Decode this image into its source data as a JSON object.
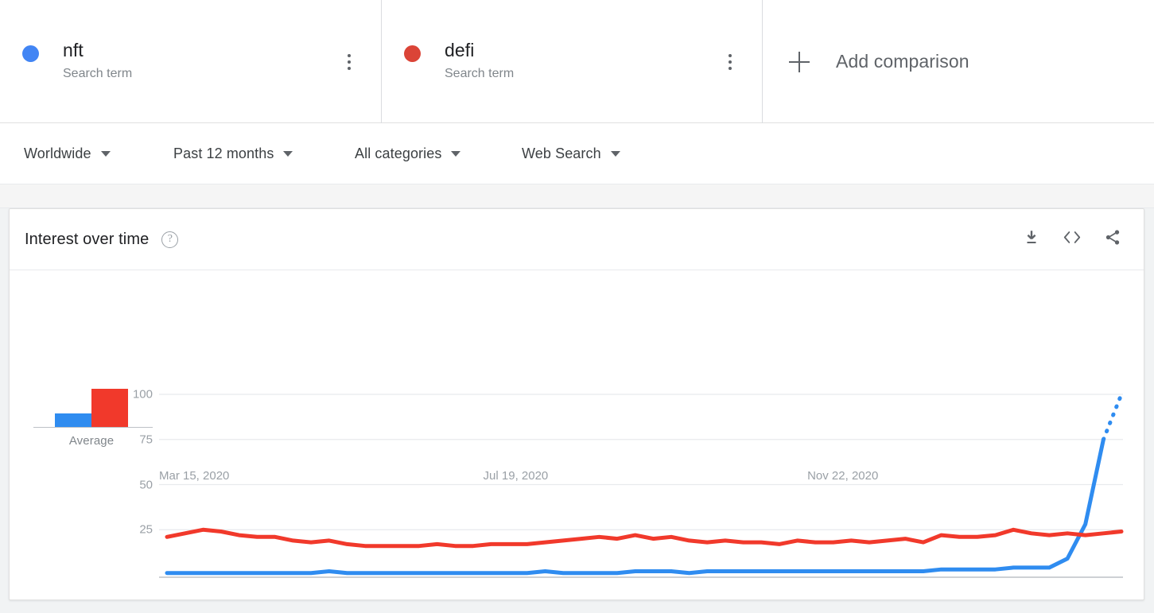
{
  "terms": [
    {
      "name": "nft",
      "subtitle": "Search term",
      "color": "#4285F4",
      "menu_icon": "kebab-menu-icon"
    },
    {
      "name": "defi",
      "subtitle": "Search term",
      "color": "#DB4437",
      "menu_icon": "kebab-menu-icon"
    }
  ],
  "add_comparison": {
    "label": "Add comparison",
    "icon": "plus-icon"
  },
  "filters": [
    {
      "label": "Worldwide",
      "icon": "chevron-down-icon"
    },
    {
      "label": "Past 12 months",
      "icon": "chevron-down-icon"
    },
    {
      "label": "All categories",
      "icon": "chevron-down-icon"
    },
    {
      "label": "Web Search",
      "icon": "chevron-down-icon"
    }
  ],
  "card": {
    "title": "Interest over time",
    "help_icon": "help-circle-icon",
    "help_glyph": "?",
    "actions": [
      {
        "name": "download-icon",
        "label": "Download"
      },
      {
        "name": "embed-code-icon",
        "label": "Embed"
      },
      {
        "name": "share-icon",
        "label": "Share"
      }
    ]
  },
  "average": {
    "label": "Average",
    "values": [
      7,
      19
    ],
    "colors": [
      "#2f8cf0",
      "#f1392b"
    ]
  },
  "chart_data": {
    "type": "line",
    "title": "Interest over time",
    "xlabel": "",
    "ylabel": "",
    "ylim": [
      0,
      100
    ],
    "yticks": [
      25,
      50,
      75,
      100
    ],
    "grid": true,
    "legend_position": "top-cards",
    "xtick_labels": [
      "Mar 15, 2020",
      "Jul 19, 2020",
      "Nov 22, 2020"
    ],
    "xtick_positions": [
      0,
      18,
      36
    ],
    "annotation": "Final blue segment is dotted, indicating partial/incomplete data",
    "series": [
      {
        "name": "nft",
        "color": "#2f8cf0",
        "values": [
          1,
          1,
          1,
          1,
          1,
          1,
          1,
          1,
          1,
          2,
          1,
          1,
          1,
          1,
          1,
          1,
          1,
          1,
          1,
          1,
          1,
          2,
          1,
          1,
          1,
          1,
          2,
          2,
          2,
          1,
          2,
          2,
          2,
          2,
          2,
          2,
          2,
          2,
          2,
          2,
          2,
          2,
          2,
          3,
          3,
          3,
          3,
          4,
          4,
          4,
          9,
          28,
          75,
          100
        ],
        "dashed_from_index": 52
      },
      {
        "name": "defi",
        "color": "#f1392b",
        "values": [
          21,
          23,
          25,
          24,
          22,
          21,
          21,
          19,
          18,
          19,
          17,
          16,
          16,
          16,
          16,
          17,
          16,
          16,
          17,
          17,
          17,
          18,
          19,
          20,
          21,
          20,
          22,
          20,
          21,
          19,
          18,
          19,
          18,
          18,
          17,
          19,
          18,
          18,
          19,
          18,
          19,
          20,
          18,
          22,
          21,
          21,
          22,
          25,
          23,
          22,
          23,
          22,
          23,
          24
        ],
        "dashed_from_index": null
      }
    ]
  }
}
